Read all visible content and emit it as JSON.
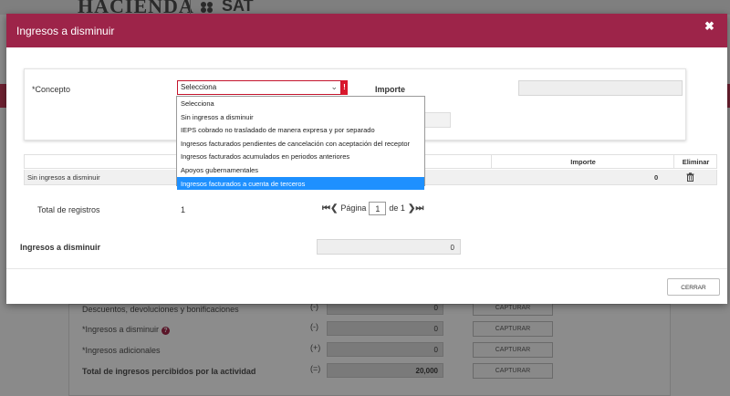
{
  "background": {
    "logo_left": "HACIENDA",
    "logo_right": "SAT",
    "rows": [
      {
        "label": "Descuentos, devoluciones y bonificaciones",
        "sign": "(-)",
        "value": "0",
        "button": "CAPTURAR",
        "bold": false,
        "help": false
      },
      {
        "label": "*Ingresos a disminuir",
        "sign": "(-)",
        "value": "0",
        "button": "CAPTURAR",
        "bold": false,
        "help": true
      },
      {
        "label": "*Ingresos adicionales",
        "sign": "(+)",
        "value": "0",
        "button": "CAPTURAR",
        "bold": false,
        "help": false
      },
      {
        "label": "Total de ingresos percibidos por la actividad",
        "sign": "(=)",
        "value": "20,000",
        "button": "CAPTURAR",
        "bold": true,
        "help": false
      }
    ],
    "help_symbol": "?"
  },
  "modal": {
    "title": "Ingresos a disminuir",
    "close_symbol": "✖",
    "form": {
      "concepto_label": "*Concepto",
      "select_value": "Selecciona",
      "select_arrow": "⌄",
      "error_symbol": "!",
      "importe_label": "Importe",
      "importe_value": ""
    },
    "dropdown": {
      "options": [
        "Selecciona",
        "Sin ingresos a disminuir",
        "IEPS cobrado no trasladado de manera expresa y por separado",
        "Ingresos facturados pendientes de cancelación con aceptación del receptor",
        "Ingresos facturados acumulados en periodos anteriores",
        "Apoyos gubernamentales",
        "Ingresos facturados a cuenta de terceros"
      ],
      "selected_index": 6
    },
    "table": {
      "headers": {
        "importe": "Importe",
        "eliminar": "Eliminar"
      },
      "rows": [
        {
          "concepto": "Sin ingresos a disminuir",
          "importe": "0"
        }
      ]
    },
    "total_registros_label": "Total de registros",
    "total_registros_value": "1",
    "pager": {
      "first": "⏮",
      "prev": "❮",
      "page_label": "Página",
      "page": "1",
      "of_label": "de 1",
      "next": "❯",
      "last": "⏭"
    },
    "ingresos_label": "Ingresos a disminuir",
    "ingresos_value": "0",
    "close_button": "CERRAR"
  }
}
